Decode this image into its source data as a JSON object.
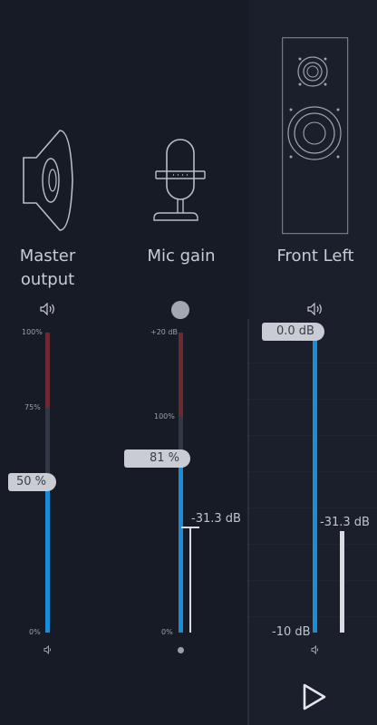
{
  "channels": [
    {
      "name_line1": "Master",
      "name_line2": "output",
      "top_icon": "speaker-volume-icon",
      "bottom_icon": "speaker-low-icon",
      "scale": {
        "top": "100%",
        "mid": "75%",
        "bottom": "0%"
      },
      "value_label": "50 %",
      "value": 0.5
    },
    {
      "name": "Mic gain",
      "top_icon": "record-dot-icon",
      "bottom_icon": "dot-icon",
      "scale": {
        "top": "+20 dB",
        "mid": "100%",
        "bottom": "0%"
      },
      "value_label": "81 %",
      "value": 0.81,
      "peak_label": "-31.3 dB"
    },
    {
      "name": "Front Left",
      "top_icon": "speaker-volume-icon",
      "bottom_icon": "speaker-low-icon",
      "value_label": "0.0 dB",
      "bottom_label": "-10 dB",
      "peak_label": "-31.3 dB"
    }
  ],
  "play_icon": "play-icon",
  "colors": {
    "background": "#171b26",
    "meter_blue": "#1a8cd8",
    "meter_red": "#6b2a30",
    "pill": "#c9ccd3"
  }
}
